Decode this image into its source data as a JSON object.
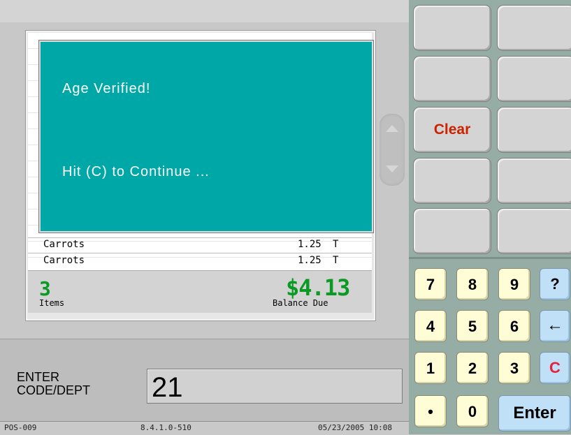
{
  "dialog": {
    "line1": "Age  Verified!",
    "line2": "Hit  (C)  to  Continue  ..."
  },
  "receipt": {
    "lines": [
      {
        "name": "Carrots",
        "price": "1.25",
        "tax": "T"
      },
      {
        "name": "Carrots",
        "price": "1.25",
        "tax": "T"
      }
    ]
  },
  "totals": {
    "items_count": "3",
    "items_label": "Items",
    "balance": "$4.13",
    "balance_label": "Balance Due"
  },
  "prompt": {
    "label_line1": "ENTER",
    "label_line2": "CODE/DEPT",
    "value": "21"
  },
  "status": {
    "terminal": "POS-009",
    "version": "8.4.1.0-510",
    "datetime": "05/23/2005 10:08"
  },
  "function_keys": {
    "clear_label": "Clear"
  },
  "keypad": {
    "seven": "7",
    "eight": "8",
    "nine": "9",
    "help": "?",
    "four": "4",
    "five": "5",
    "six": "6",
    "backspace": "←",
    "one": "1",
    "two": "2",
    "three": "3",
    "c": "C",
    "dot": "•",
    "zero": "0",
    "enter": "Enter"
  },
  "colors": {
    "dialog_bg": "#00a7a7",
    "total_green": "#0a9a23",
    "clear_red": "#cc2200",
    "numeric_key": "#fefdd6",
    "blue_key": "#bfe0f7",
    "panel_teal": "#96ada6"
  },
  "icons": {
    "scroll_up": "triangle-up",
    "scroll_down": "triangle-down",
    "backspace": "left-arrow"
  }
}
